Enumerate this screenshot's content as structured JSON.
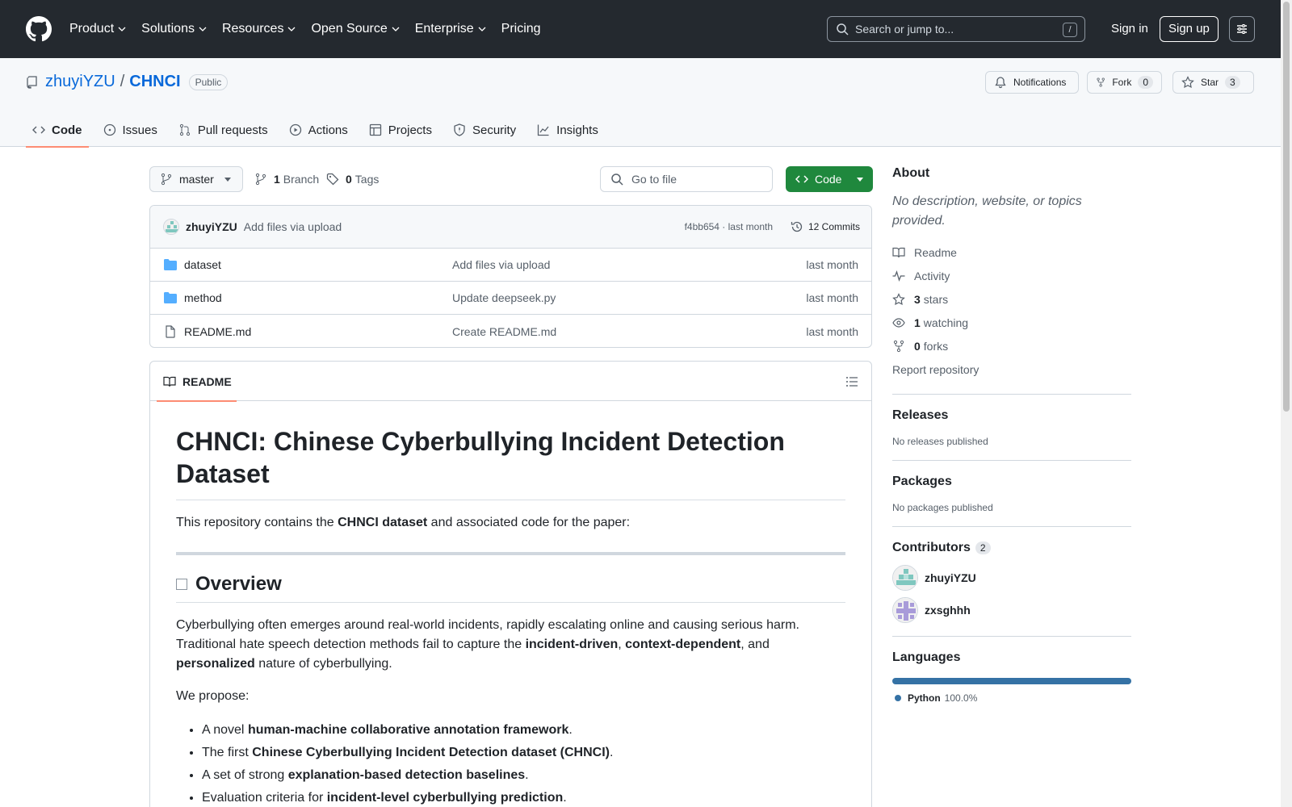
{
  "header": {
    "nav": [
      {
        "label": "Product",
        "has_menu": true
      },
      {
        "label": "Solutions",
        "has_menu": true
      },
      {
        "label": "Resources",
        "has_menu": true
      },
      {
        "label": "Open Source",
        "has_menu": true
      },
      {
        "label": "Enterprise",
        "has_menu": true
      },
      {
        "label": "Pricing",
        "has_menu": false
      }
    ],
    "search_placeholder": "Search or jump to...",
    "search_key": "/",
    "signin": "Sign in",
    "signup": "Sign up"
  },
  "repo": {
    "owner": "zhuyiYZU",
    "separator": "/",
    "name": "CHNCI",
    "visibility": "Public",
    "notifications": "Notifications",
    "fork_label": "Fork",
    "fork_count": "0",
    "star_label": "Star",
    "star_count": "3",
    "tabs": [
      {
        "label": "Code",
        "icon": "code-icon",
        "active": true
      },
      {
        "label": "Issues",
        "icon": "issue-icon",
        "active": false
      },
      {
        "label": "Pull requests",
        "icon": "pull-request-icon",
        "active": false
      },
      {
        "label": "Actions",
        "icon": "play-icon",
        "active": false
      },
      {
        "label": "Projects",
        "icon": "table-icon",
        "active": false
      },
      {
        "label": "Security",
        "icon": "shield-icon",
        "active": false
      },
      {
        "label": "Insights",
        "icon": "graph-icon",
        "active": false
      }
    ]
  },
  "browser": {
    "branch": "master",
    "branch_count": "1",
    "branch_label": "Branch",
    "tag_count": "0",
    "tag_label": "Tags",
    "go_to_file": "Go to file",
    "code_button": "Code",
    "latest_commit": {
      "author": "zhuyiYZU",
      "message": "Add files via upload",
      "meta": "f4bb654 · last month",
      "commits": "12 Commits"
    },
    "files": [
      {
        "name": "dataset",
        "type": "folder",
        "message": "Add files via upload",
        "date": "last month"
      },
      {
        "name": "method",
        "type": "folder",
        "message": "Update deepseek.py",
        "date": "last month"
      },
      {
        "name": "README.md",
        "type": "file",
        "message": "Create README.md",
        "date": "last month"
      }
    ]
  },
  "readme": {
    "tab": "README",
    "title": "CHNCI: Chinese Cyberbullying Incident Detection Dataset",
    "intro_pre": "This repository contains the ",
    "intro_bold": "CHNCI dataset",
    "intro_post": " and associated code for the paper:",
    "overview_heading": "Overview",
    "overview": {
      "t1": "Cyberbullying often emerges around real-world incidents, rapidly escalating online and causing serious harm. Traditional hate speech detection methods fail to capture the ",
      "b1": "incident-driven",
      "t2": ", ",
      "b2": "context-dependent",
      "t3": ", and ",
      "b3": "personalized",
      "t4": " nature of cyberbullying."
    },
    "propose": "We propose:",
    "bullets": [
      {
        "pre": "A novel ",
        "bold": "human-machine collaborative annotation framework",
        "post": "."
      },
      {
        "pre": "The first ",
        "bold": "Chinese Cyberbullying Incident Detection dataset (CHNCI)",
        "post": "."
      },
      {
        "pre": "A set of strong ",
        "bold": "explanation-based detection baselines",
        "post": "."
      },
      {
        "pre": "Evaluation criteria for ",
        "bold": "incident-level cyberbullying prediction",
        "post": "."
      }
    ]
  },
  "sidebar": {
    "about_title": "About",
    "about_desc": "No description, website, or topics provided.",
    "readme": "Readme",
    "activity": "Activity",
    "stars_count": "3",
    "stars_label": "stars",
    "watching_count": "1",
    "watching_label": "watching",
    "forks_count": "0",
    "forks_label": "forks",
    "report": "Report repository",
    "releases_title": "Releases",
    "releases_empty": "No releases published",
    "packages_title": "Packages",
    "packages_empty": "No packages published",
    "contributors_title": "Contributors",
    "contributors_count": "2",
    "contributors": [
      {
        "name": "zhuyiYZU"
      },
      {
        "name": "zxsghhh"
      }
    ],
    "languages_title": "Languages",
    "languages": [
      {
        "name": "Python",
        "percent": "100.0%",
        "color": "#3572a5"
      }
    ]
  },
  "colors": {
    "header_bg": "#24292f",
    "link": "#0969da",
    "code_button": "#1f883d",
    "tab_underline": "#fd8c73"
  }
}
